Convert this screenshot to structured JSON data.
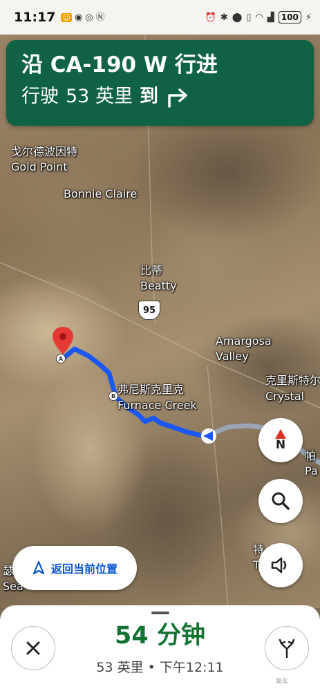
{
  "status_bar": {
    "time": "11:17",
    "left_icons": [
      "app-icon",
      "location-icon",
      "nfc-icon",
      "n-icon"
    ],
    "right_icons": [
      "alarm-icon",
      "bluetooth-icon",
      "location-icon",
      "vibrate-icon",
      "wifi-icon",
      "signal-icon"
    ],
    "battery": "100"
  },
  "banner": {
    "road": "沿 CA-190 W 行进",
    "distance_prefix": "行驶",
    "distance_value": "53 英里",
    "distance_suffix": "到",
    "turn_icon": "turn-right-icon",
    "color": "#0f6344"
  },
  "map": {
    "labels": {
      "gold_point_cn": "戈尔德波因特",
      "gold_point_en": "Gold Point",
      "bonnie_claire": "Bonnie Claire",
      "beatty_cn": "比蒂",
      "beatty_en": "Beatty",
      "highway": "95",
      "amargosa_1": "Amargosa",
      "amargosa_2": "Valley",
      "crystal_cn": "克里斯特尔",
      "crystal_en": "Crystal",
      "furnace_cn": "弗尼斯克里克",
      "furnace_en": "Furnace Creek",
      "pahrump_cn": "帕",
      "pahrump_en": "Pa",
      "te_cn": "特",
      "te_en": "T",
      "sea_cn": "瑟",
      "sea_en": "Sea"
    },
    "route_color": "#1a57f5",
    "marker_a": "A",
    "marker_b": "B"
  },
  "controls": {
    "compass_label": "N",
    "recenter_label": "返回当前位置"
  },
  "bottom_sheet": {
    "eta_duration": "54 分钟",
    "eta_details": "53 英里 • 下午12:11",
    "eta_color": "#137333",
    "watermark": "易车"
  }
}
